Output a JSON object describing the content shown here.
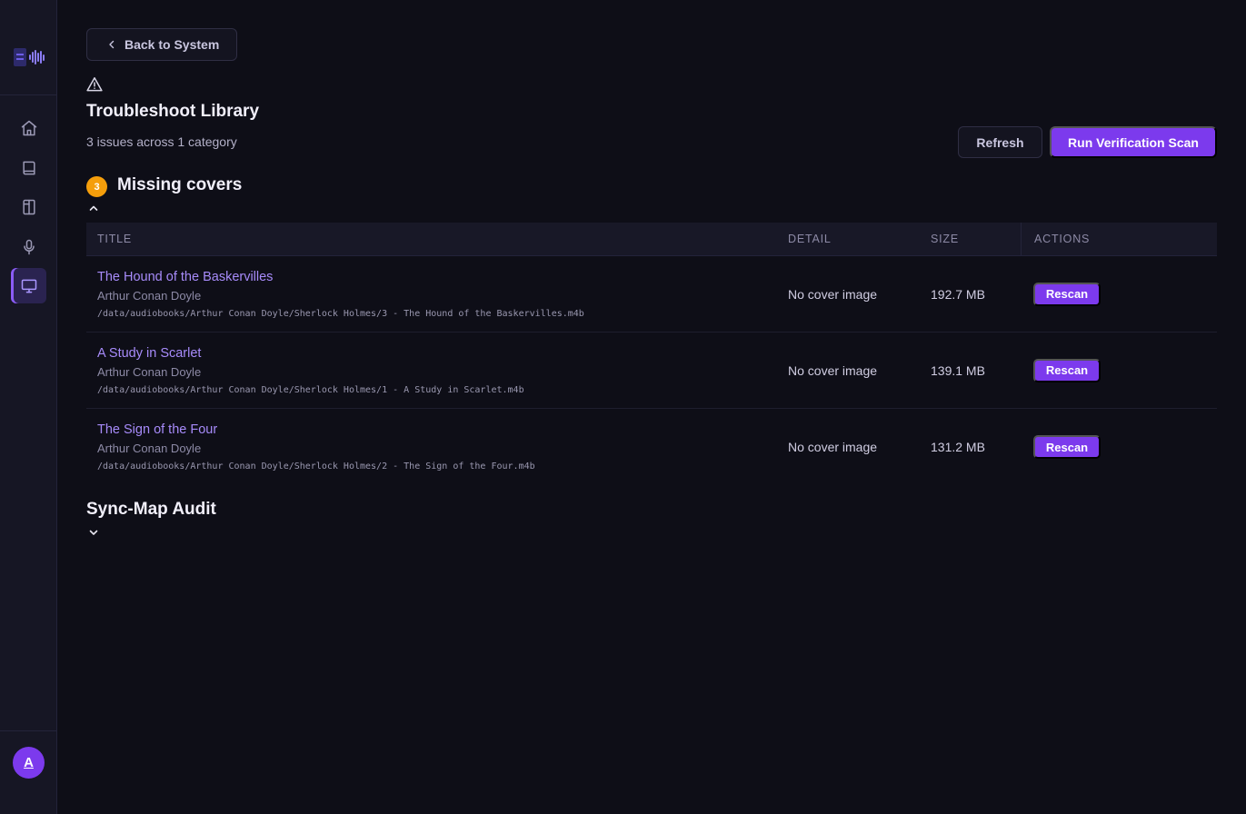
{
  "sidebar": {
    "nav": [
      {
        "icon": "home-icon"
      },
      {
        "icon": "book-icon"
      },
      {
        "icon": "library-icon"
      },
      {
        "icon": "microphone-icon"
      },
      {
        "icon": "monitor-icon",
        "active": true
      }
    ],
    "avatar_initial": "A"
  },
  "header": {
    "back_label": "Back to System",
    "title": "Troubleshoot Library",
    "subtitle": "3 issues across 1 category",
    "refresh_label": "Refresh",
    "scan_label": "Run Verification Scan"
  },
  "section": {
    "badge_count": "3",
    "title": "Missing covers",
    "expanded": true,
    "columns": [
      "TITLE",
      "DETAIL",
      "SIZE",
      "ACTIONS"
    ],
    "rows": [
      {
        "title": "The Hound of the Baskervilles",
        "author": "Arthur Conan Doyle",
        "path": "/data/audiobooks/Arthur Conan Doyle/Sherlock Holmes/3 - The Hound of the Baskervilles.m4b",
        "detail": "No cover image",
        "size": "192.7 MB",
        "action": "Rescan"
      },
      {
        "title": "A Study in Scarlet",
        "author": "Arthur Conan Doyle",
        "path": "/data/audiobooks/Arthur Conan Doyle/Sherlock Holmes/1 - A Study in Scarlet.m4b",
        "detail": "No cover image",
        "size": "139.1 MB",
        "action": "Rescan"
      },
      {
        "title": "The Sign of the Four",
        "author": "Arthur Conan Doyle",
        "path": "/data/audiobooks/Arthur Conan Doyle/Sherlock Holmes/2 - The Sign of the Four.m4b",
        "detail": "No cover image",
        "size": "131.2 MB",
        "action": "Rescan"
      }
    ]
  },
  "sync_section": {
    "title": "Sync-Map Audit",
    "expanded": false
  },
  "colors": {
    "accent": "#7c3aed",
    "link": "#a78bfa",
    "badge": "#f59e0b",
    "background": "#0e0e17"
  }
}
